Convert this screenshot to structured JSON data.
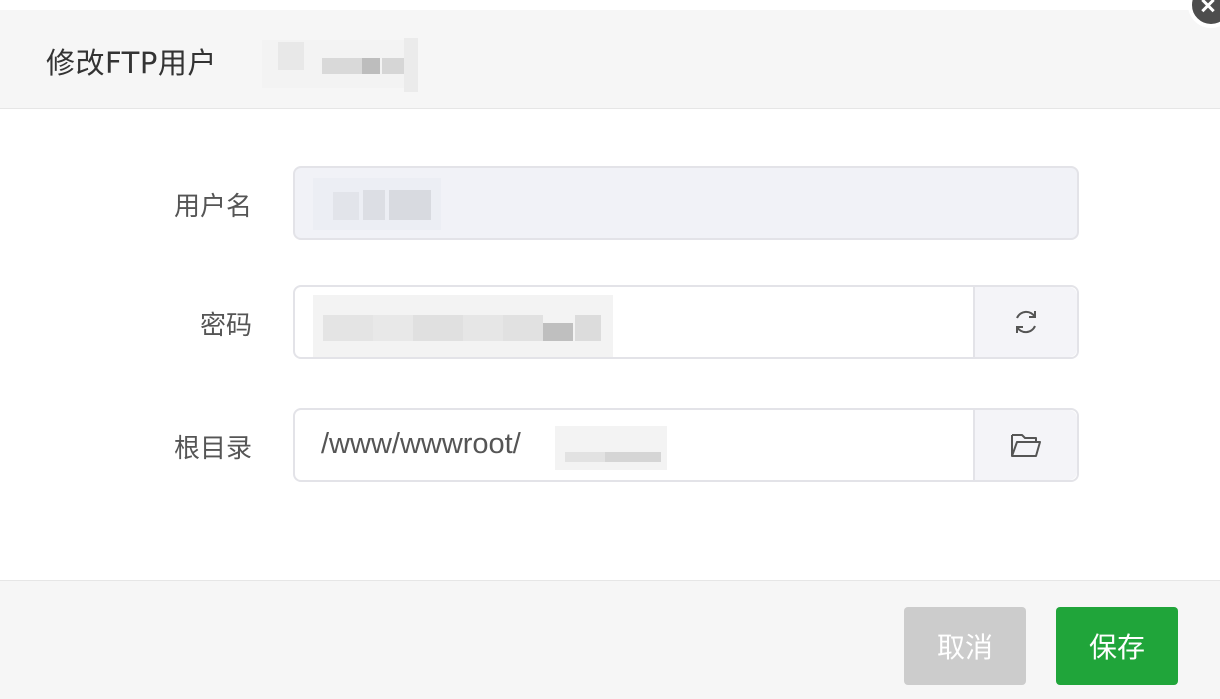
{
  "dialog": {
    "title": "修改FTP用户"
  },
  "form": {
    "username": {
      "label": "用户名"
    },
    "password": {
      "label": "密码"
    },
    "root_dir": {
      "label": "根目录",
      "value": "/www/wwwroot/"
    }
  },
  "footer": {
    "cancel_label": "取消",
    "save_label": "保存"
  },
  "colors": {
    "save_button": "#20a53a",
    "cancel_button": "#cccccc",
    "header_bg": "#f6f6f6"
  },
  "icons": {
    "password_button": "refresh-icon",
    "root_dir_button": "folder-icon"
  }
}
